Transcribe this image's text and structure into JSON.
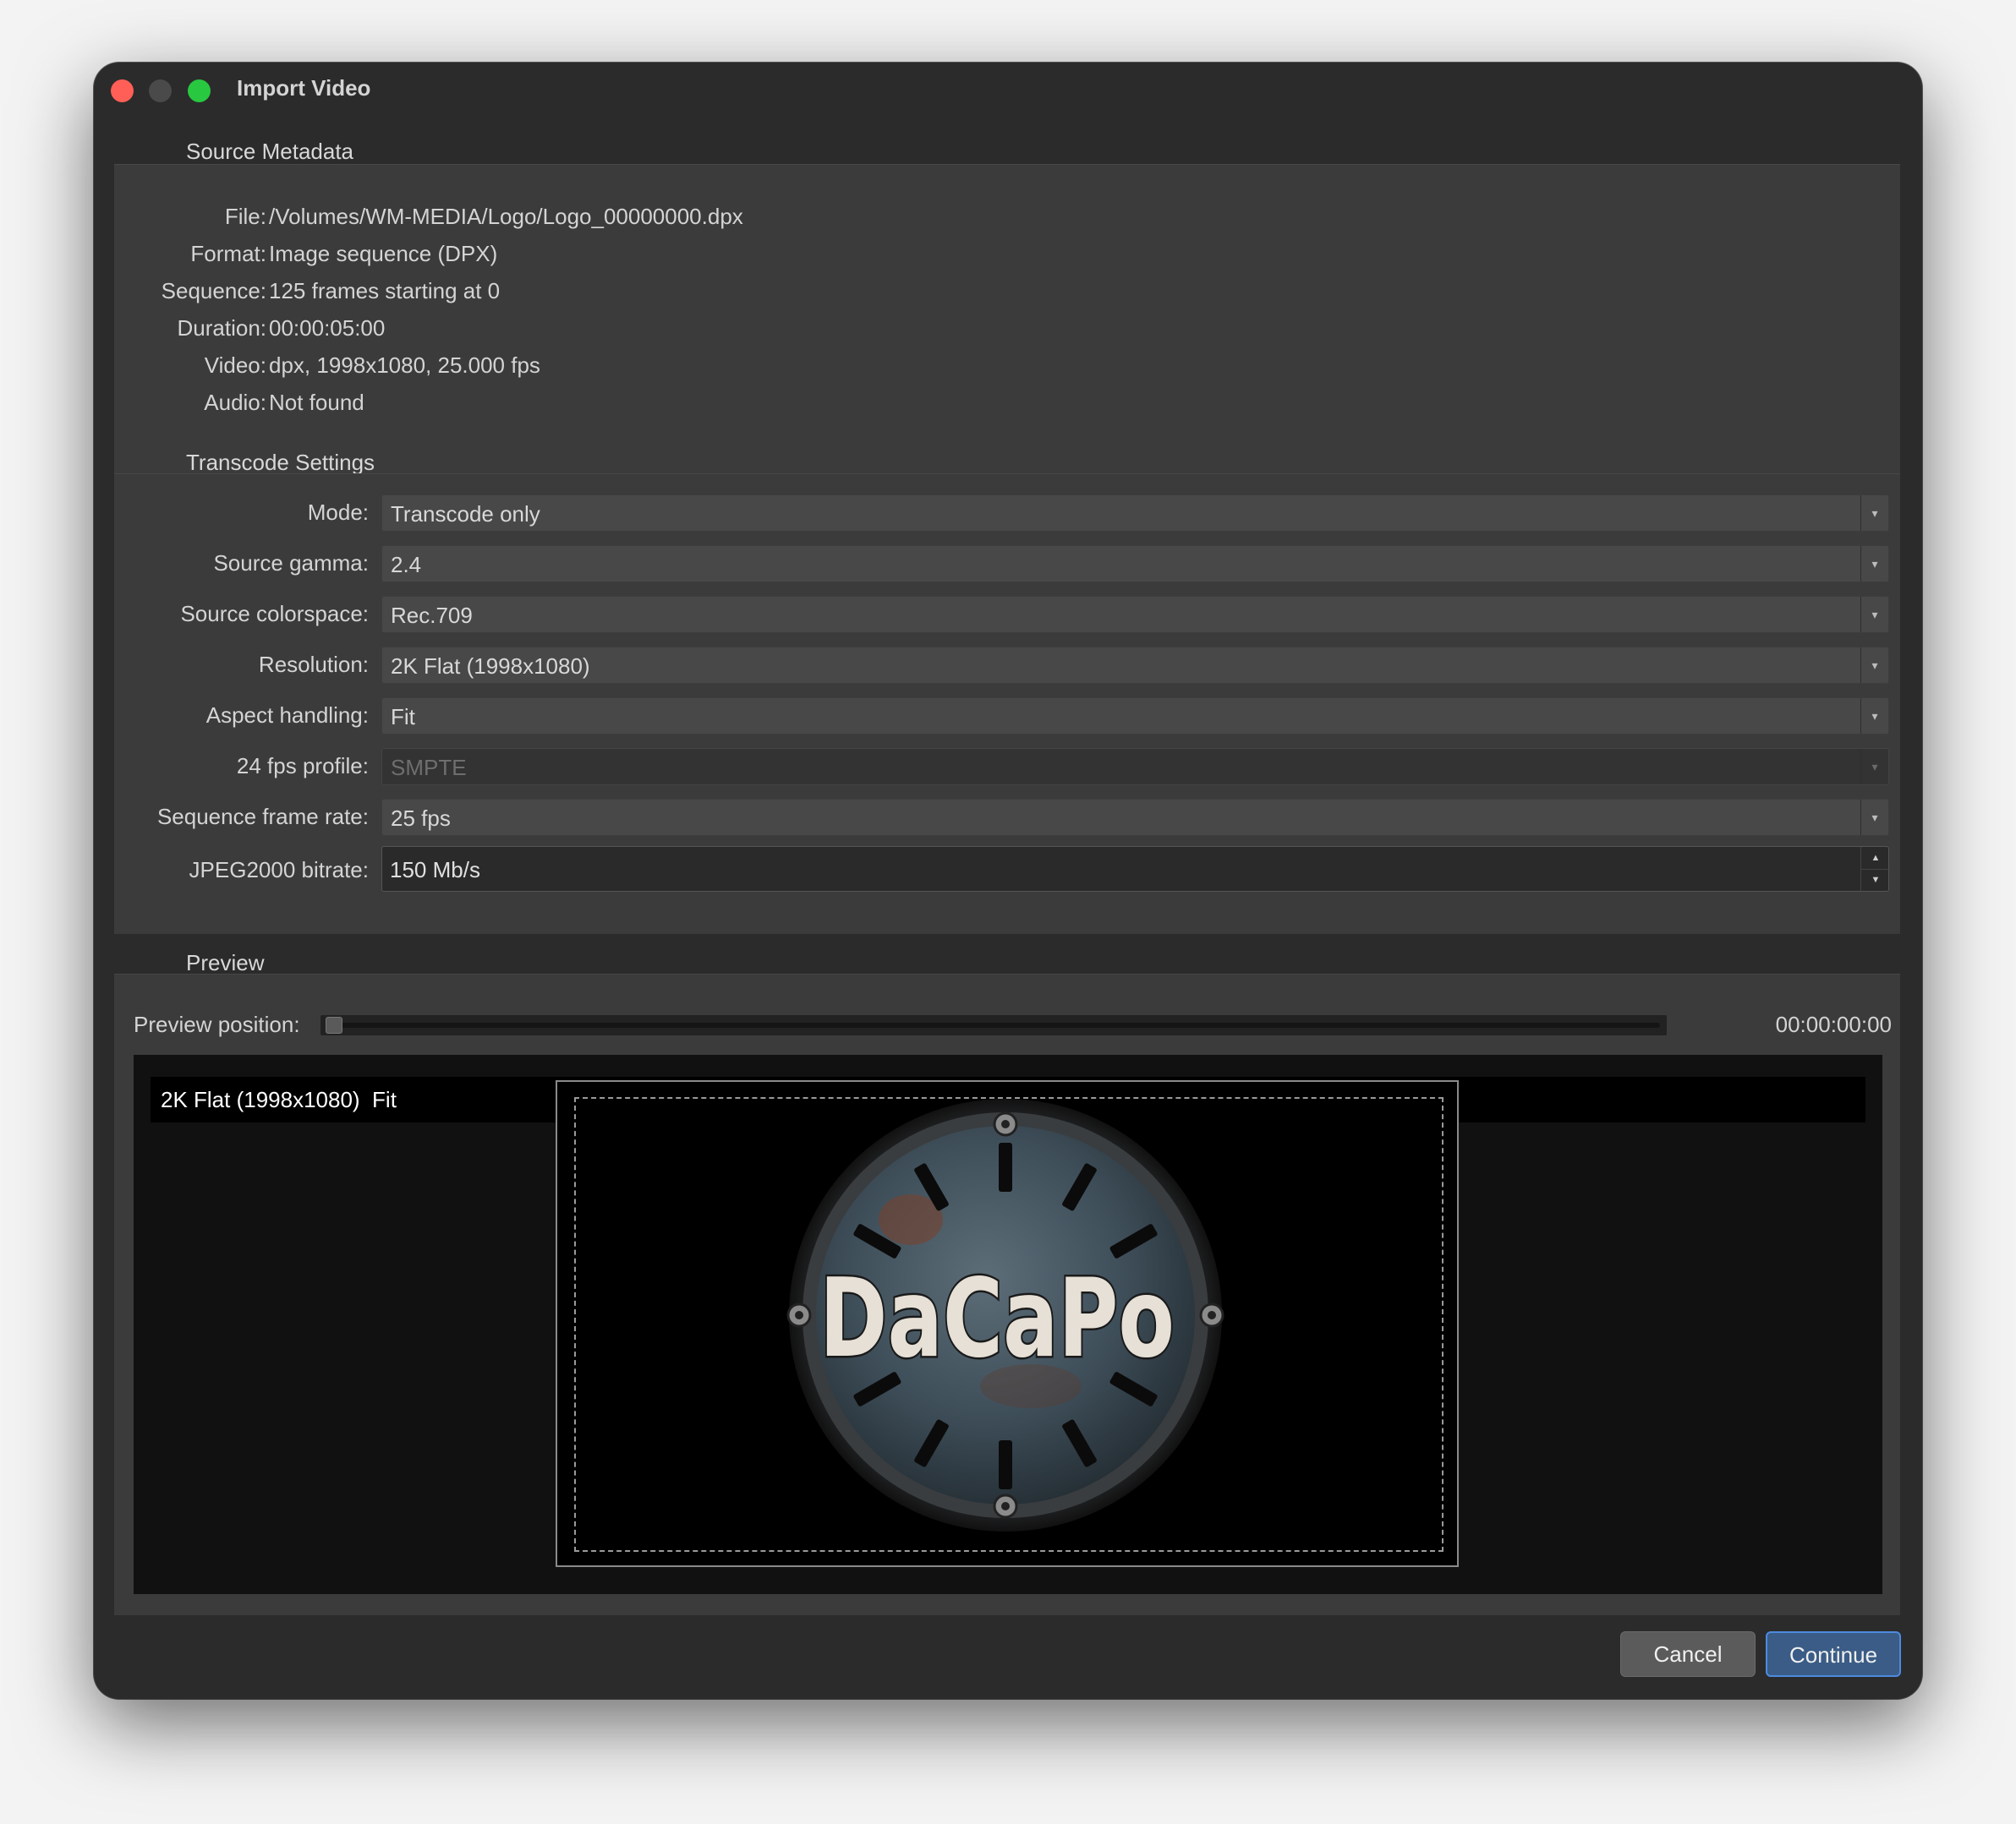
{
  "window": {
    "title": "Import Video"
  },
  "source_metadata": {
    "group_title": "Source Metadata",
    "rows": [
      {
        "label": "File:",
        "value": "/Volumes/WM-MEDIA/Logo/Logo_00000000.dpx"
      },
      {
        "label": "Format:",
        "value": "Image sequence (DPX)"
      },
      {
        "label": "Sequence:",
        "value": "125 frames starting at 0"
      },
      {
        "label": "Duration:",
        "value": "00:00:05:00"
      },
      {
        "label": "Video:",
        "value": "dpx, 1998x1080, 25.000 fps"
      },
      {
        "label": "Audio:",
        "value": "Not found"
      }
    ]
  },
  "transcode_settings": {
    "group_title": "Transcode Settings",
    "mode": {
      "label": "Mode:",
      "value": "Transcode only"
    },
    "source_gamma": {
      "label": "Source gamma:",
      "value": "2.4"
    },
    "source_colorspace": {
      "label": "Source colorspace:",
      "value": "Rec.709"
    },
    "resolution": {
      "label": "Resolution:",
      "value": "2K Flat (1998x1080)"
    },
    "aspect_handling": {
      "label": "Aspect handling:",
      "value": "Fit"
    },
    "fps24_profile": {
      "label": "24 fps profile:",
      "value": "SMPTE"
    },
    "sequence_frame_rate": {
      "label": "Sequence frame rate:",
      "value": "25 fps"
    },
    "jpeg2000_bitrate": {
      "label": "JPEG2000 bitrate:",
      "value": "150 Mb/s"
    }
  },
  "preview": {
    "group_title": "Preview",
    "position_label": "Preview position:",
    "position_value": 0,
    "timecode": "00:00:00:00",
    "overlay_resolution": "2K Flat (1998x1080)",
    "overlay_aspect": "Fit",
    "logo_text": "DaCaPo"
  },
  "buttons": {
    "cancel": "Cancel",
    "continue": "Continue"
  },
  "colors": {
    "accent": "#4d8be0",
    "window_bg": "#2b2b2b",
    "group_bg": "#3b3b3b"
  }
}
